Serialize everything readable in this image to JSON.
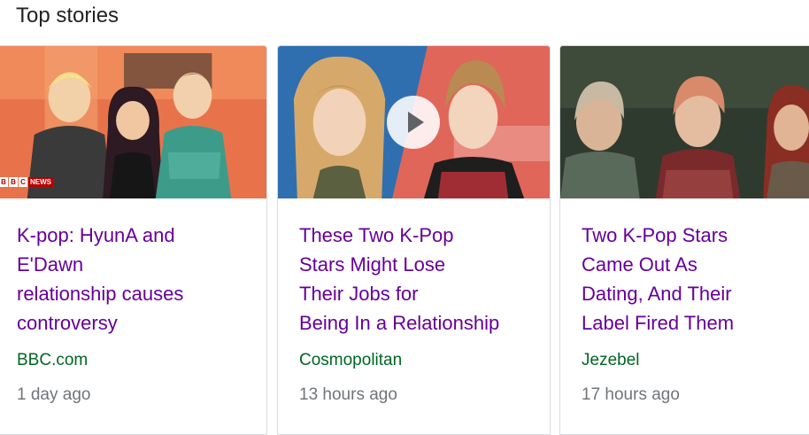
{
  "section": {
    "title": "Top stories"
  },
  "cards": [
    {
      "headline": "K-pop: HyunA and E'Dawn relationship causes controversy",
      "headline_lines": [
        "K-pop: HyunA and",
        "E'Dawn",
        "relationship causes",
        "controversy"
      ],
      "source": "BBC.com",
      "time": "1 day ago",
      "image_badge": {
        "blocks": [
          "B",
          "B",
          "C"
        ],
        "news": "NEWS"
      }
    },
    {
      "headline": "These Two K-Pop Stars Might Lose Their Jobs for Being In a Relationship",
      "headline_lines": [
        "These Two K-Pop",
        "Stars Might Lose",
        "Their Jobs for",
        "Being In a Relationship"
      ],
      "source": "Cosmopolitan",
      "time": "13 hours ago",
      "has_video": true
    },
    {
      "headline": "Two K-Pop Stars Came Out As Dating, And Their Label Fired Them",
      "headline_lines": [
        "Two K-Pop Stars",
        "Came Out As",
        "Dating, And Their",
        "Label Fired Them"
      ],
      "source": "Jezebel",
      "time": "17 hours ago"
    }
  ],
  "colors": {
    "headline": "#660099",
    "source": "#006621",
    "time": "#70757a",
    "border": "#dadce0"
  }
}
